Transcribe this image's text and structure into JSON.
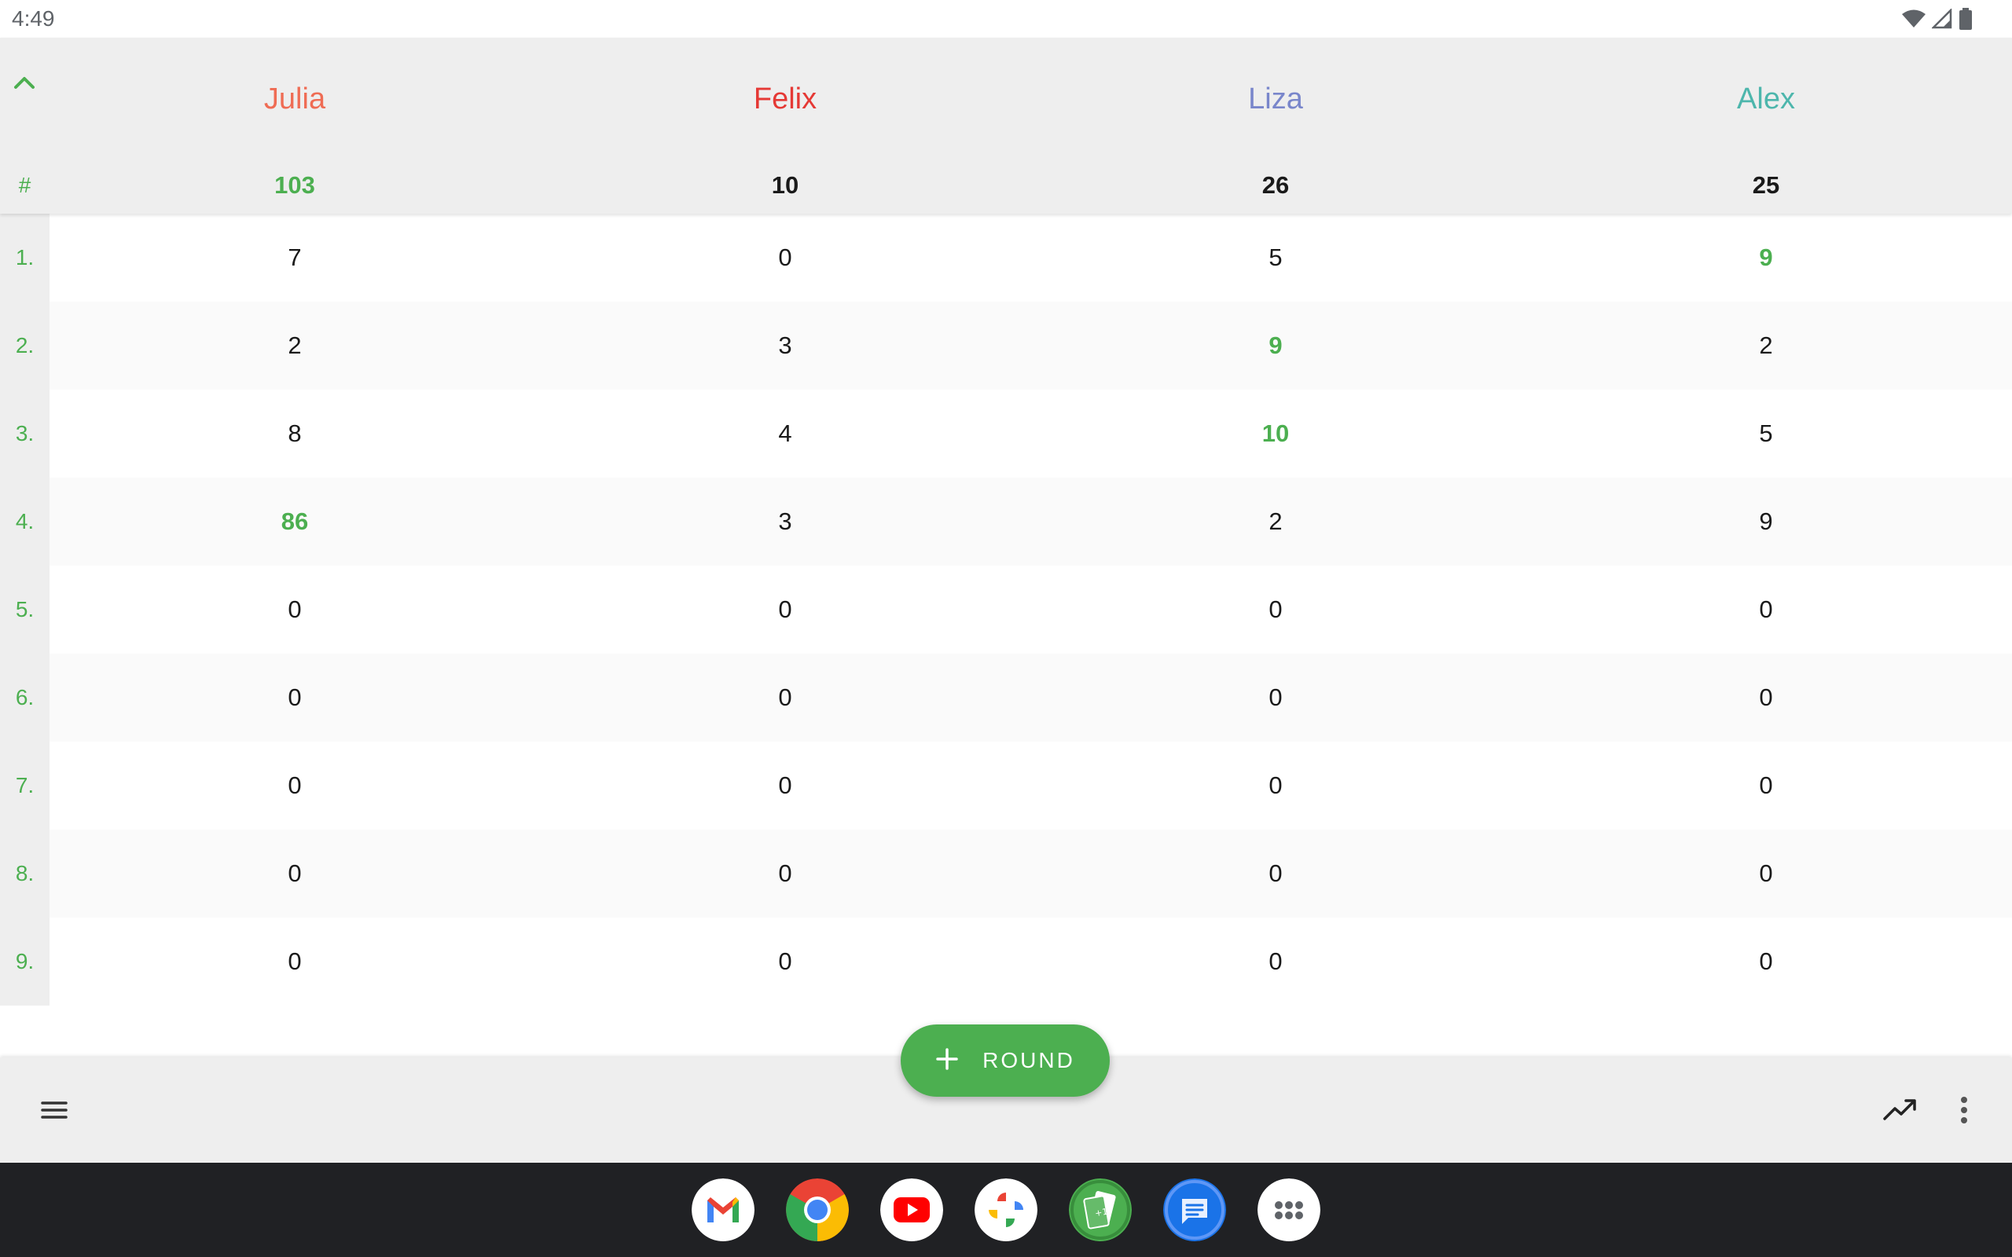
{
  "status_bar": {
    "time": "4:49",
    "icons": [
      "wifi-icon",
      "signal-icon",
      "battery-icon"
    ]
  },
  "colors": {
    "accent": "#4caf50",
    "header_bg": "#eeeeee",
    "dock_bg": "#202124"
  },
  "players": [
    {
      "name": "Julia",
      "color": "#ef6c54"
    },
    {
      "name": "Felix",
      "color": "#e53935"
    },
    {
      "name": "Liza",
      "color": "#7986cb"
    },
    {
      "name": "Alex",
      "color": "#4db6ac"
    }
  ],
  "totals_label": "#",
  "totals": [
    {
      "value": "103",
      "max": true
    },
    {
      "value": "10",
      "max": false
    },
    {
      "value": "26",
      "max": false
    },
    {
      "value": "25",
      "max": false
    }
  ],
  "rounds": [
    {
      "label": "1.",
      "scores": [
        {
          "v": "7",
          "max": false
        },
        {
          "v": "0",
          "max": false
        },
        {
          "v": "5",
          "max": false
        },
        {
          "v": "9",
          "max": true
        }
      ]
    },
    {
      "label": "2.",
      "scores": [
        {
          "v": "2",
          "max": false
        },
        {
          "v": "3",
          "max": false
        },
        {
          "v": "9",
          "max": true
        },
        {
          "v": "2",
          "max": false
        }
      ]
    },
    {
      "label": "3.",
      "scores": [
        {
          "v": "8",
          "max": false
        },
        {
          "v": "4",
          "max": false
        },
        {
          "v": "10",
          "max": true
        },
        {
          "v": "5",
          "max": false
        }
      ]
    },
    {
      "label": "4.",
      "scores": [
        {
          "v": "86",
          "max": true
        },
        {
          "v": "3",
          "max": false
        },
        {
          "v": "2",
          "max": false
        },
        {
          "v": "9",
          "max": false
        }
      ]
    },
    {
      "label": "5.",
      "scores": [
        {
          "v": "0",
          "max": false
        },
        {
          "v": "0",
          "max": false
        },
        {
          "v": "0",
          "max": false
        },
        {
          "v": "0",
          "max": false
        }
      ]
    },
    {
      "label": "6.",
      "scores": [
        {
          "v": "0",
          "max": false
        },
        {
          "v": "0",
          "max": false
        },
        {
          "v": "0",
          "max": false
        },
        {
          "v": "0",
          "max": false
        }
      ]
    },
    {
      "label": "7.",
      "scores": [
        {
          "v": "0",
          "max": false
        },
        {
          "v": "0",
          "max": false
        },
        {
          "v": "0",
          "max": false
        },
        {
          "v": "0",
          "max": false
        }
      ]
    },
    {
      "label": "8.",
      "scores": [
        {
          "v": "0",
          "max": false
        },
        {
          "v": "0",
          "max": false
        },
        {
          "v": "0",
          "max": false
        },
        {
          "v": "0",
          "max": false
        }
      ]
    },
    {
      "label": "9.",
      "scores": [
        {
          "v": "0",
          "max": false
        },
        {
          "v": "0",
          "max": false
        },
        {
          "v": "0",
          "max": false
        },
        {
          "v": "0",
          "max": false
        }
      ]
    }
  ],
  "fab": {
    "label": "ROUND",
    "icon": "plus-icon"
  },
  "bottom_bar": {
    "left_icon": "menu-icon",
    "right_icons": [
      "chart-icon",
      "more-vert-icon"
    ]
  },
  "dock": {
    "apps": [
      "gmail-icon",
      "chrome-icon",
      "youtube-icon",
      "photos-icon",
      "score-counter-icon",
      "messages-icon",
      "app-drawer-icon"
    ]
  }
}
